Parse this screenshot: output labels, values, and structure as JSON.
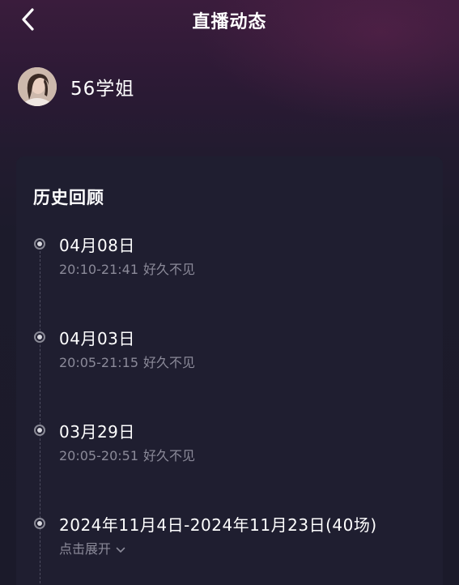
{
  "header": {
    "title": "直播动态",
    "back_icon": "chevron-left-icon"
  },
  "host": {
    "name": "56学姐",
    "avatar_icon": "avatar-photo"
  },
  "history": {
    "title": "历史回顾",
    "items": [
      {
        "date": "04月08日",
        "time": "20:10-21:41",
        "topic": "好久不见"
      },
      {
        "date": "04月03日",
        "time": "20:05-21:15",
        "topic": "好久不见"
      },
      {
        "date": "03月29日",
        "time": "20:05-20:51",
        "topic": "好久不见"
      }
    ],
    "range": {
      "label": "2024年11月4日-2024年11月23日(40场)",
      "expand_label": "点击展开",
      "expand_icon": "chevron-down-icon"
    }
  },
  "colors": {
    "background": "#1b1a2a",
    "card": "#1f1e30",
    "secondary_text": "#8b8a99"
  }
}
